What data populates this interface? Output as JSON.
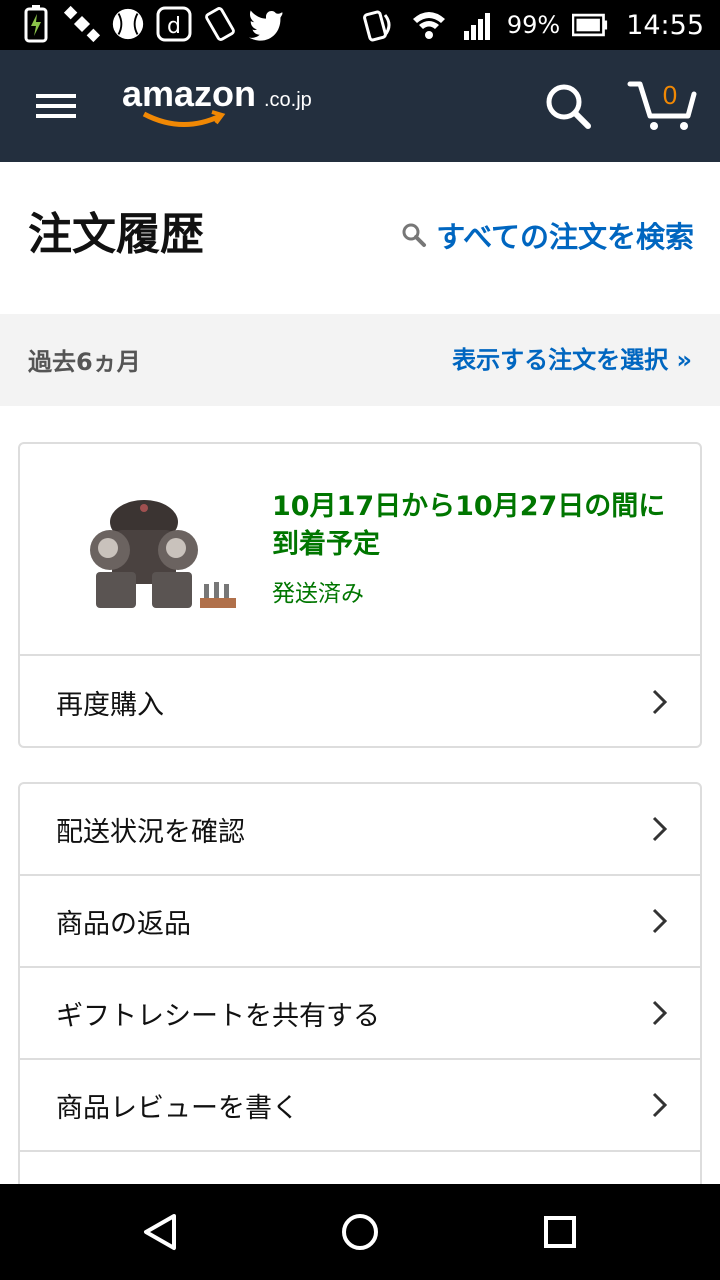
{
  "status_bar": {
    "battery_percent": "99%",
    "time": "14:55",
    "left_icons": [
      "battery-charging-icon",
      "satellite-icon",
      "baseball-icon",
      "d-app-icon",
      "phone-shake-icon",
      "twitter-icon"
    ],
    "right_icons": [
      "nfc-icon",
      "wifi-icon",
      "signal-icon",
      "battery-icon"
    ]
  },
  "header": {
    "logo_text": "amazon",
    "logo_suffix": ".co.jp",
    "cart_count": "0",
    "colors": {
      "background": "#232f3e",
      "accent": "#f08804"
    }
  },
  "page": {
    "title": "注文履歴",
    "search_all_label": "すべての注文を検索"
  },
  "filter": {
    "period": "過去6ヵ月",
    "select_label": "表示する注文を選択 »"
  },
  "order": {
    "delivery_text": "10月17日から10月27日の間に到着予定",
    "status": "発送済み",
    "rebuy_label": "再度購入",
    "colors": {
      "delivery": "#007600",
      "link": "#0066c0"
    }
  },
  "actions": [
    {
      "label": "配送状況を確認"
    },
    {
      "label": "商品の返品"
    },
    {
      "label": "ギフトレシートを共有する"
    },
    {
      "label": "商品レビューを書く"
    }
  ]
}
